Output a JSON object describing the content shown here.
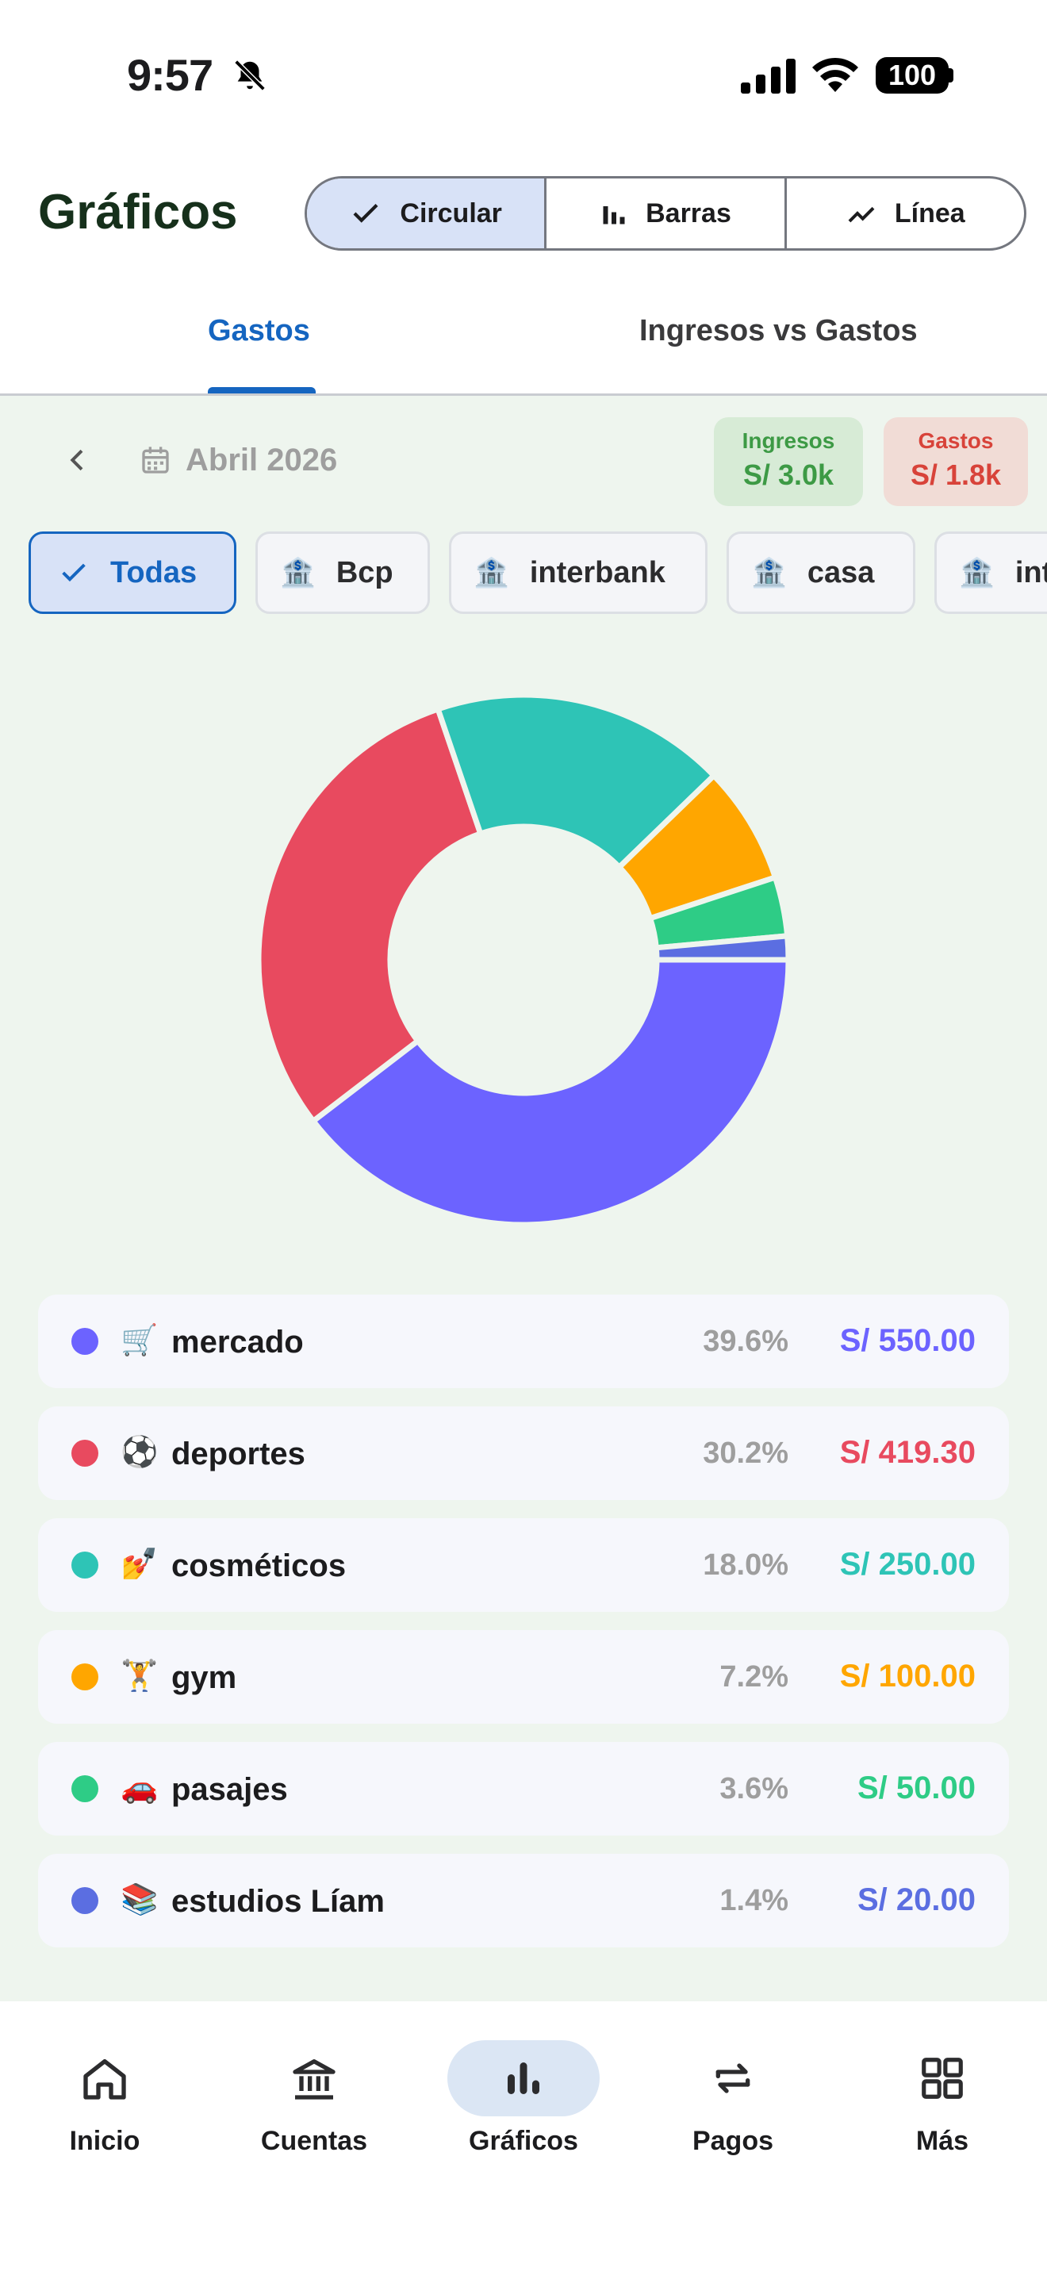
{
  "status": {
    "time": "9:57",
    "battery": "100"
  },
  "header": {
    "title": "Gráficos",
    "segments": [
      {
        "label": "Circular",
        "icon": "check-icon",
        "active": true
      },
      {
        "label": "Barras",
        "icon": "bar-chart-icon",
        "active": false
      },
      {
        "label": "Línea",
        "icon": "line-chart-icon",
        "active": false
      }
    ]
  },
  "tabs": [
    {
      "label": "Gastos",
      "active": true
    },
    {
      "label": "Ingresos vs Gastos",
      "active": false
    }
  ],
  "period": "Abril 2026",
  "summary": {
    "ingresos_label": "Ingresos",
    "ingresos_value": "S/ 3.0k",
    "gastos_label": "Gastos",
    "gastos_value": "S/ 1.8k"
  },
  "filters": [
    {
      "label": "Todas",
      "active": true
    },
    {
      "label": "Bcp",
      "active": false
    },
    {
      "label": "interbank",
      "active": false
    },
    {
      "label": "casa",
      "active": false
    },
    {
      "label": "interbank",
      "active": false
    }
  ],
  "chart_data": {
    "type": "pie",
    "donut": true,
    "categories": [
      "mercado",
      "deportes",
      "cosméticos",
      "gym",
      "pasajes",
      "estudios Líam"
    ],
    "values": [
      550.0,
      419.3,
      250.0,
      100.0,
      50.0,
      20.0
    ],
    "percentages": [
      "39.6%",
      "30.2%",
      "18.0%",
      "7.2%",
      "3.6%",
      "1.4%"
    ],
    "amounts": [
      "S/ 550.00",
      "S/ 419.30",
      "S/ 250.00",
      "S/ 100.00",
      "S/ 50.00",
      "S/ 20.00"
    ],
    "emojis": [
      "🛒",
      "⚽",
      "💅",
      "🏋",
      "🚗",
      "📚"
    ],
    "colors": [
      "#6c63ff",
      "#e84a5f",
      "#2ec4b6",
      "#ffa600",
      "#2ecc86",
      "#5b6ee1"
    ]
  },
  "nav": [
    {
      "label": "Inicio",
      "icon": "home-icon",
      "active": false
    },
    {
      "label": "Cuentas",
      "icon": "bank-icon",
      "active": false
    },
    {
      "label": "Gráficos",
      "icon": "chart-icon",
      "active": true
    },
    {
      "label": "Pagos",
      "icon": "transfer-icon",
      "active": false
    },
    {
      "label": "Más",
      "icon": "grid-icon",
      "active": false
    }
  ]
}
